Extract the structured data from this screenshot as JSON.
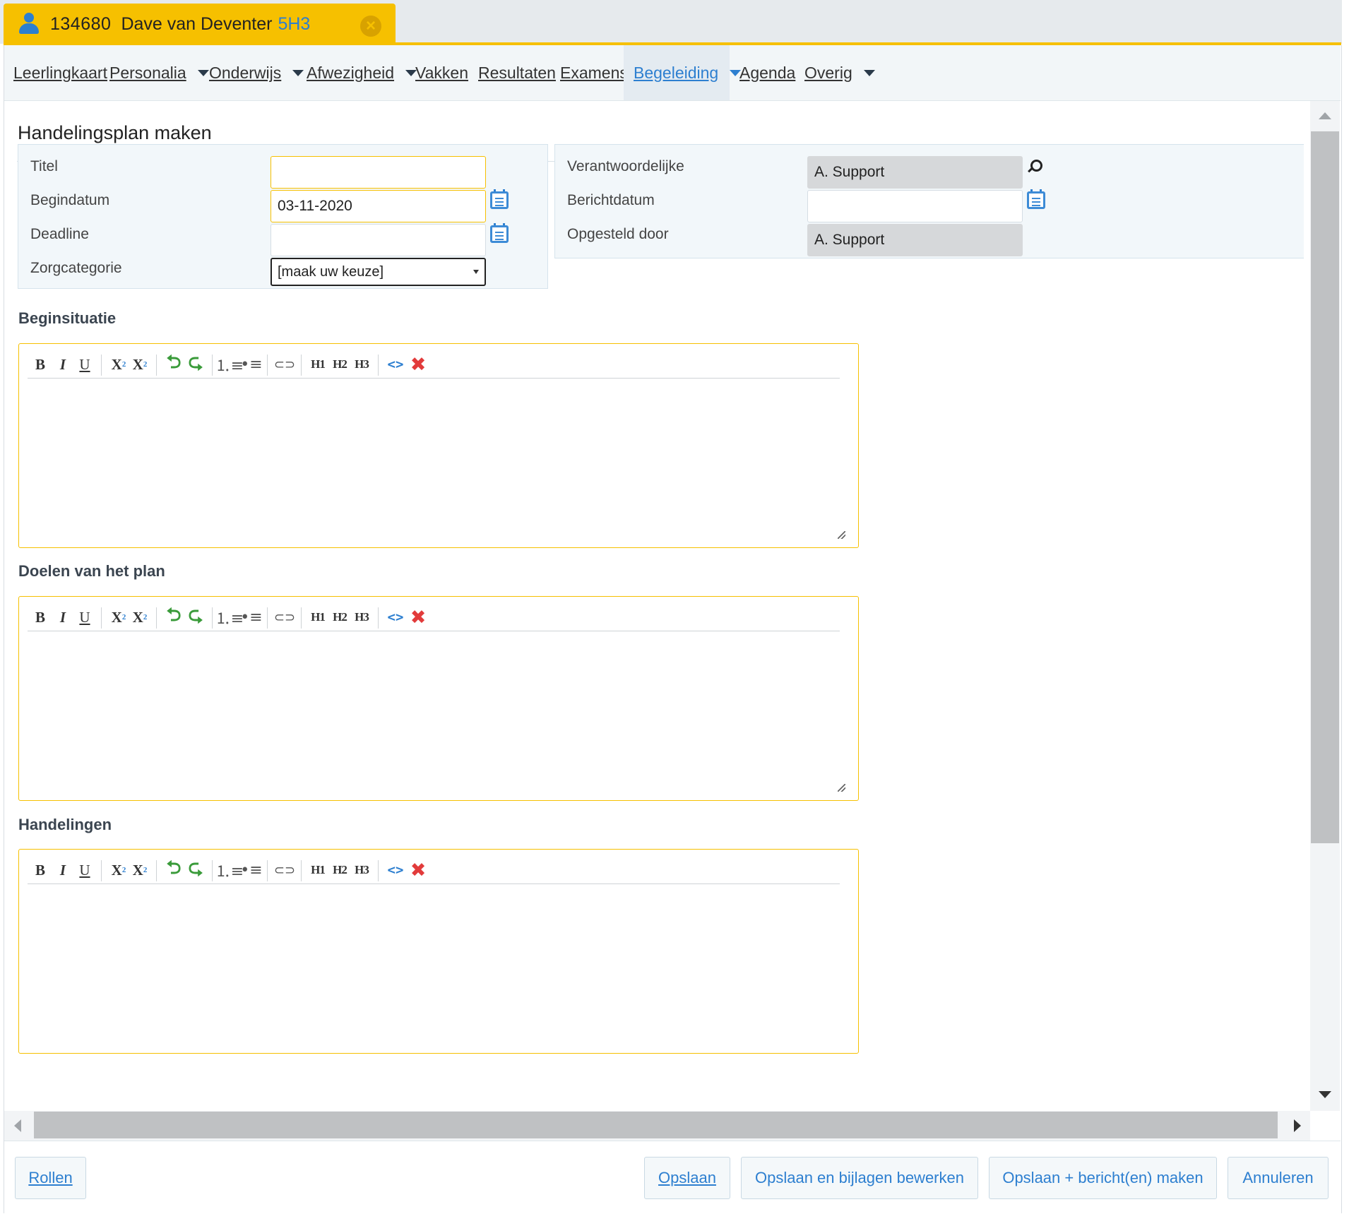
{
  "student_tab": {
    "student_id": "134680",
    "student_name": "Dave van Deventer",
    "class": "5H3",
    "close_icon": "×"
  },
  "nav": {
    "items": [
      {
        "label": "Leerlingkaart",
        "has_dropdown": false
      },
      {
        "label": "Personalia",
        "has_dropdown": true
      },
      {
        "label": "Onderwijs",
        "has_dropdown": true
      },
      {
        "label": "Afwezigheid",
        "has_dropdown": true
      },
      {
        "label": "Vakken",
        "has_dropdown": false
      },
      {
        "label": "Resultaten",
        "has_dropdown": false
      },
      {
        "label": "Examens",
        "has_dropdown": false
      },
      {
        "label": "Begeleiding",
        "has_dropdown": true,
        "active": true
      },
      {
        "label": "Agenda",
        "has_dropdown": false
      },
      {
        "label": "Overig",
        "has_dropdown": true
      }
    ]
  },
  "page": {
    "title": "Handelingsplan maken"
  },
  "form_left": {
    "titel": {
      "label": "Titel",
      "value": ""
    },
    "begindatum": {
      "label": "Begindatum",
      "value": "03-11-2020"
    },
    "deadline": {
      "label": "Deadline",
      "value": ""
    },
    "zorgcategorie": {
      "label": "Zorgcategorie",
      "selected": "[maak uw keuze]"
    }
  },
  "form_right": {
    "verantwoordelijke": {
      "label": "Verantwoordelijke",
      "value": "A. Support"
    },
    "berichtdatum": {
      "label": "Berichtdatum",
      "value": ""
    },
    "opgesteld_door": {
      "label": "Opgesteld door",
      "value": "A. Support"
    }
  },
  "sections": [
    {
      "heading": "Beginsituatie"
    },
    {
      "heading": "Doelen van het plan"
    },
    {
      "heading": "Handelingen"
    }
  ],
  "editor_toolbar": {
    "bold": "B",
    "italic": "I",
    "underline": "U",
    "subscript": "X",
    "subscript_mark": "2",
    "superscript": "X",
    "superscript_mark": "2",
    "undo": "⮌",
    "redo": "⮎",
    "ordered_list": "⒈≡",
    "unordered_list": "•≡",
    "link": "⊂⊃",
    "h1": "H1",
    "h2": "H2",
    "h3": "H3",
    "code": "<>",
    "clear": "✖"
  },
  "footer": {
    "rollen": "Rollen",
    "opslaan": "Opslaan",
    "opslaan_bijlagen": "Opslaan en bijlagen bewerken",
    "opslaan_bericht": "Opslaan + bericht(en) maken",
    "annuleren": "Annuleren"
  },
  "colors": {
    "accent_yellow": "#f6c000",
    "link_blue": "#2d7fd0",
    "panel_bg": "#f2f7fa",
    "readonly_bg": "#d6d8da"
  },
  "icons": {
    "student": "person-icon",
    "close": "close-circle-icon",
    "calendar": "calendar-icon",
    "search": "magnifier-icon"
  }
}
